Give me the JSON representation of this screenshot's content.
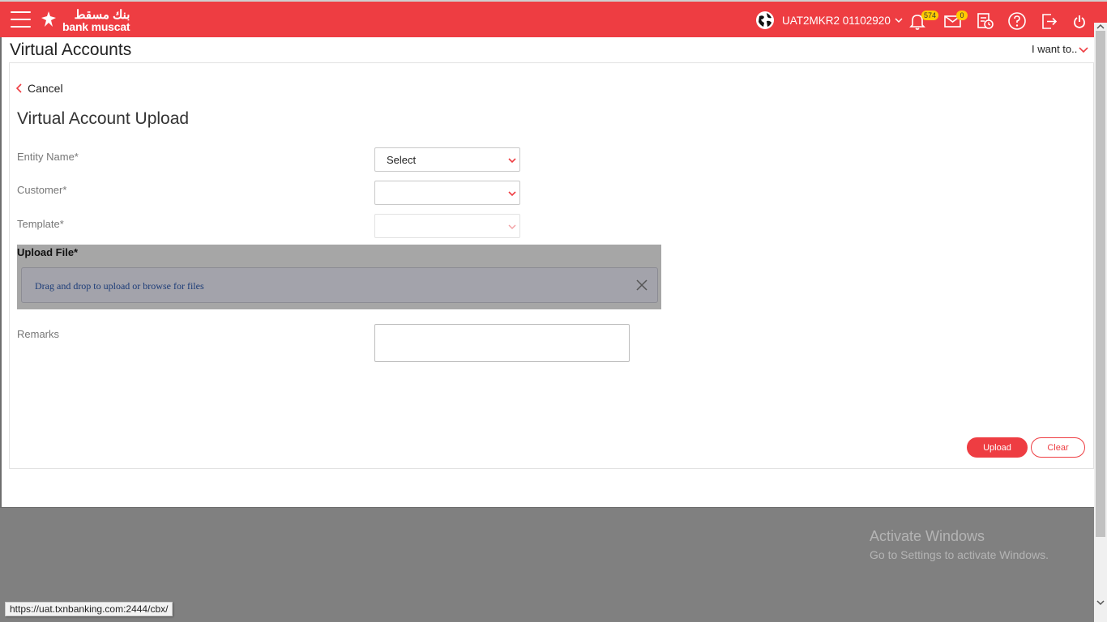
{
  "header": {
    "brand_arabic": "بنك مسقط",
    "brand_latin": "bank muscat",
    "user_name": "UAT2MKR2 01102920",
    "notification_count": "574",
    "message_count": "0",
    "icons": [
      "menu-icon",
      "globe-icon",
      "bell-icon",
      "mail-icon",
      "activity-log-icon",
      "help-icon",
      "exit-icon",
      "power-icon"
    ],
    "colors": {
      "brand_red": "#ee3d42",
      "badge": "#ffcc00"
    }
  },
  "page": {
    "title": "Virtual Accounts",
    "i_want_to": "I want to.."
  },
  "form": {
    "cancel_label": "Cancel",
    "section_title": "Virtual Account Upload",
    "entity_name_label": "Entity Name*",
    "entity_name_value": "Select",
    "customer_label": "Customer*",
    "customer_value": "",
    "template_label": "Template*",
    "template_value": "",
    "upload_file_label": "Upload File*",
    "dropzone_text": "Drag and drop to upload or browse for files",
    "remarks_label": "Remarks",
    "remarks_value": "",
    "upload_button": "Upload",
    "clear_button": "Clear"
  },
  "os": {
    "activate_title": "Activate Windows",
    "activate_subtitle": "Go to Settings to activate Windows.",
    "status_url": "https://uat.txnbanking.com:2444/cbx/"
  }
}
